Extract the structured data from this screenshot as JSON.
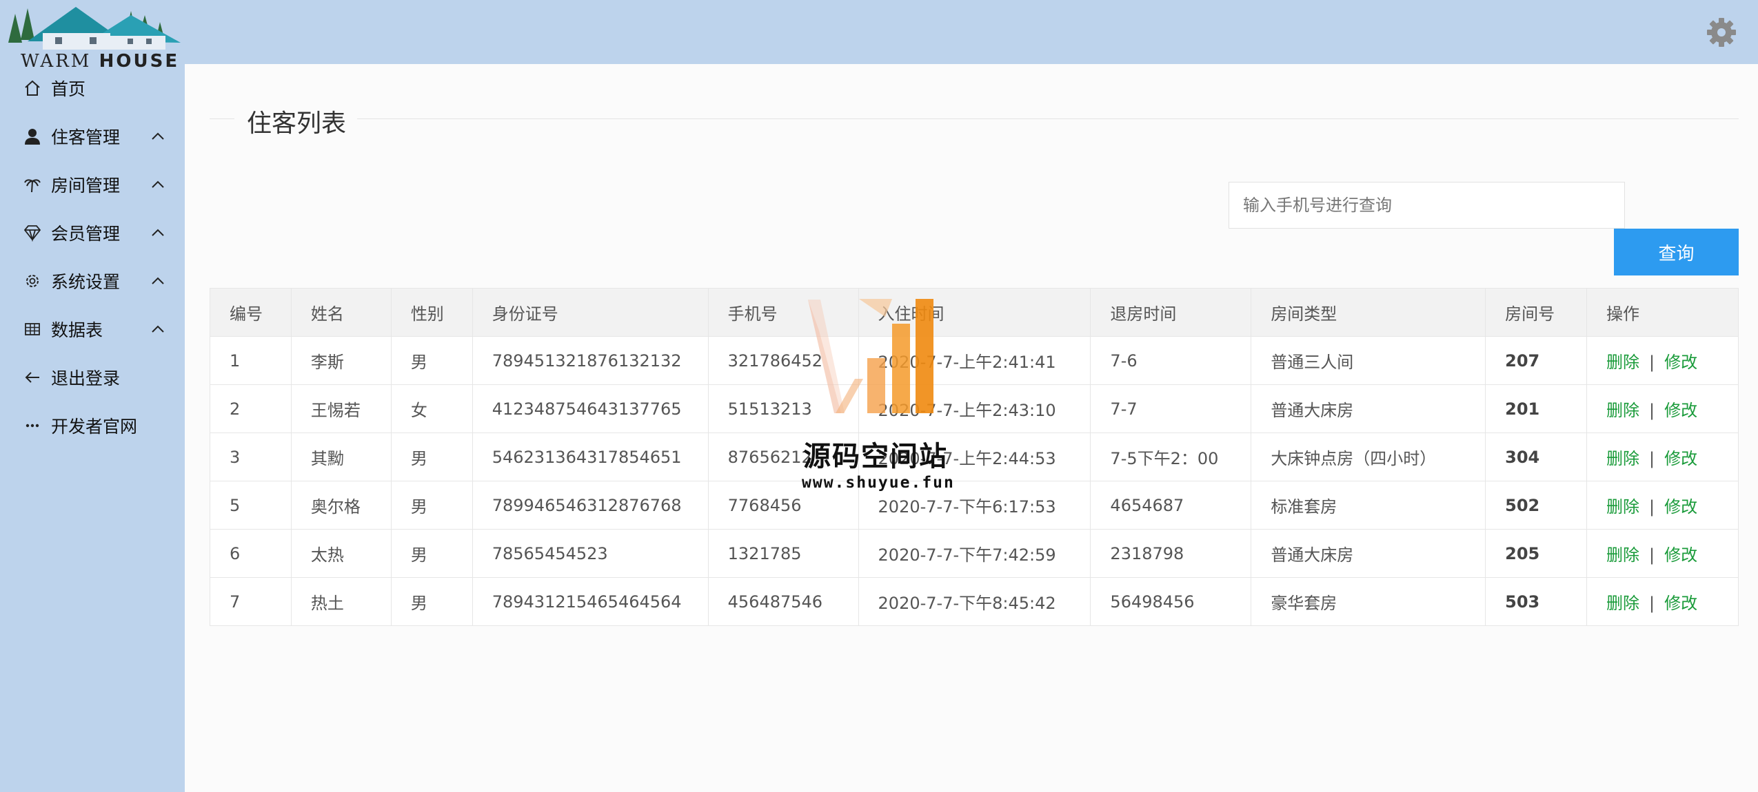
{
  "logo": {
    "text_a": "WARM ",
    "text_b": "HOUSE"
  },
  "sidebar": {
    "items": [
      {
        "label": "首页",
        "icon": "home-icon",
        "has_chevron": false
      },
      {
        "label": "住客管理",
        "icon": "user-icon",
        "has_chevron": true
      },
      {
        "label": "房间管理",
        "icon": "palm-tree-icon",
        "has_chevron": true
      },
      {
        "label": "会员管理",
        "icon": "diamond-icon",
        "has_chevron": true
      },
      {
        "label": "系统设置",
        "icon": "gear-icon",
        "has_chevron": true
      },
      {
        "label": "数据表",
        "icon": "table-icon",
        "has_chevron": true
      },
      {
        "label": "退出登录",
        "icon": "arrow-left-icon",
        "has_chevron": false
      },
      {
        "label": "开发者官网",
        "icon": "more-icon",
        "has_chevron": false
      }
    ]
  },
  "main": {
    "title": "住客列表",
    "search": {
      "placeholder": "输入手机号进行查询",
      "button": "查询"
    },
    "table": {
      "headers": [
        "编号",
        "姓名",
        "性别",
        "身份证号",
        "手机号",
        "入住时间",
        "退房时间",
        "房间类型",
        "房间号",
        "操作"
      ],
      "rows": [
        {
          "id": "1",
          "name": "李斯",
          "gender": "男",
          "idcard": "789451321876132132",
          "phone": "321786452",
          "checkin": "2020-7-7-上午2:41:41",
          "checkout": "7-6",
          "room_type": "普通三人间",
          "room": "207"
        },
        {
          "id": "2",
          "name": "王惕若",
          "gender": "女",
          "idcard": "412348754643137765",
          "phone": "51513213",
          "checkin": "2020-7-7-上午2:43:10",
          "checkout": "7-7",
          "room_type": "普通大床房",
          "room": "201"
        },
        {
          "id": "3",
          "name": "其黝",
          "gender": "男",
          "idcard": "546231364317854651",
          "phone": "87656212",
          "checkin": "2020-7-7-上午2:44:53",
          "checkout": "7-5下午2：00",
          "room_type": "大床钟点房（四小时）",
          "room": "304"
        },
        {
          "id": "5",
          "name": "奥尔格",
          "gender": "男",
          "idcard": "789946546312876768",
          "phone": "7768456",
          "checkin": "2020-7-7-下午6:17:53",
          "checkout": "4654687",
          "room_type": "标准套房",
          "room": "502"
        },
        {
          "id": "6",
          "name": "太热",
          "gender": "男",
          "idcard": "78565454523",
          "phone": "1321785",
          "checkin": "2020-7-7-下午7:42:59",
          "checkout": "2318798",
          "room_type": "普通大床房",
          "room": "205"
        },
        {
          "id": "7",
          "name": "热土",
          "gender": "男",
          "idcard": "789431215465464564",
          "phone": "456487546",
          "checkin": "2020-7-7-下午8:45:42",
          "checkout": "56498456",
          "room_type": "豪华套房",
          "room": "503"
        }
      ],
      "actions": {
        "delete": "删除",
        "separator": "|",
        "edit": "修改"
      }
    }
  },
  "watermark": {
    "title": "源码空间站",
    "url": "www.shuyue.fun"
  },
  "colors": {
    "sidebar_bg": "#bdd3ec",
    "button_bg": "#2d9bf0",
    "action_link": "#1a9b3a"
  }
}
